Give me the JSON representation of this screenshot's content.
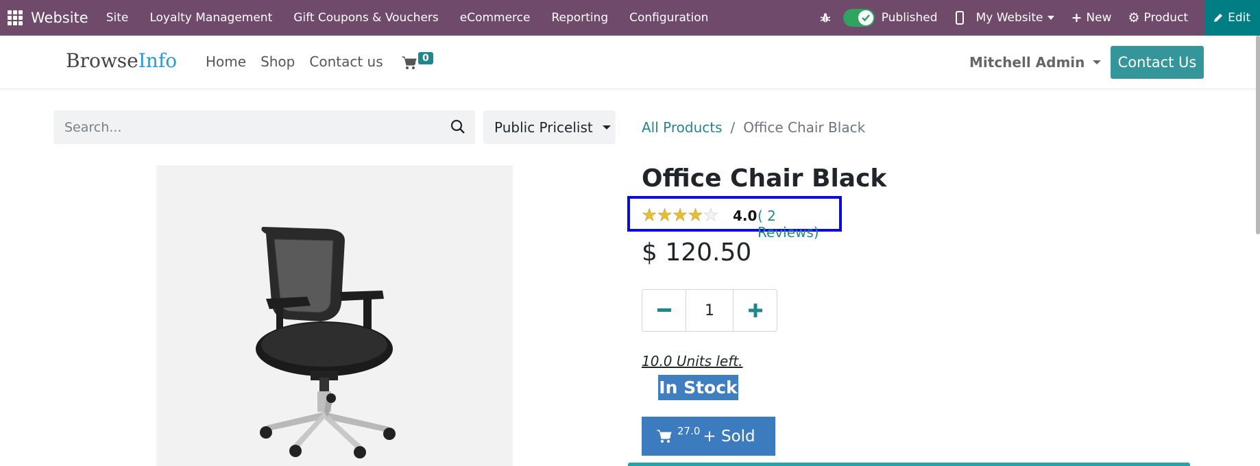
{
  "adminbar": {
    "brand": "Website",
    "menu": [
      "Site",
      "Loyalty Management",
      "Gift Coupons & Vouchers",
      "eCommerce",
      "Reporting",
      "Configuration"
    ],
    "published_label": "Published",
    "website_selector": "My Website",
    "new_label": "New",
    "product_label": "Product",
    "edit_label": "Edit"
  },
  "header": {
    "logo_part1": "Browse",
    "logo_part2": "Info",
    "nav": [
      "Home",
      "Shop",
      "Contact us"
    ],
    "cart_count": "0",
    "user": "Mitchell Admin",
    "contact_button": "Contact Us"
  },
  "search": {
    "placeholder": "Search...",
    "pricelist": "Public Pricelist"
  },
  "breadcrumb": {
    "parent": "All Products",
    "separator": "/",
    "current": "Office Chair Black"
  },
  "product": {
    "title": "Office Chair Black",
    "rating_value": "4.0",
    "rating_stars": 4,
    "reviews": "( 2 Reviews)",
    "price": "$ 120.50",
    "quantity": "1",
    "units_left": "10.0 Units left.",
    "stock_status": "In Stock",
    "sold_count": "27.0",
    "sold_label": "+ Sold"
  },
  "colors": {
    "adminbar": "#6f4a6a",
    "accent": "#24868d",
    "edit": "#017e84",
    "highlight_box": "#0b0bd8",
    "stock_badge": "#3f7fc0"
  }
}
